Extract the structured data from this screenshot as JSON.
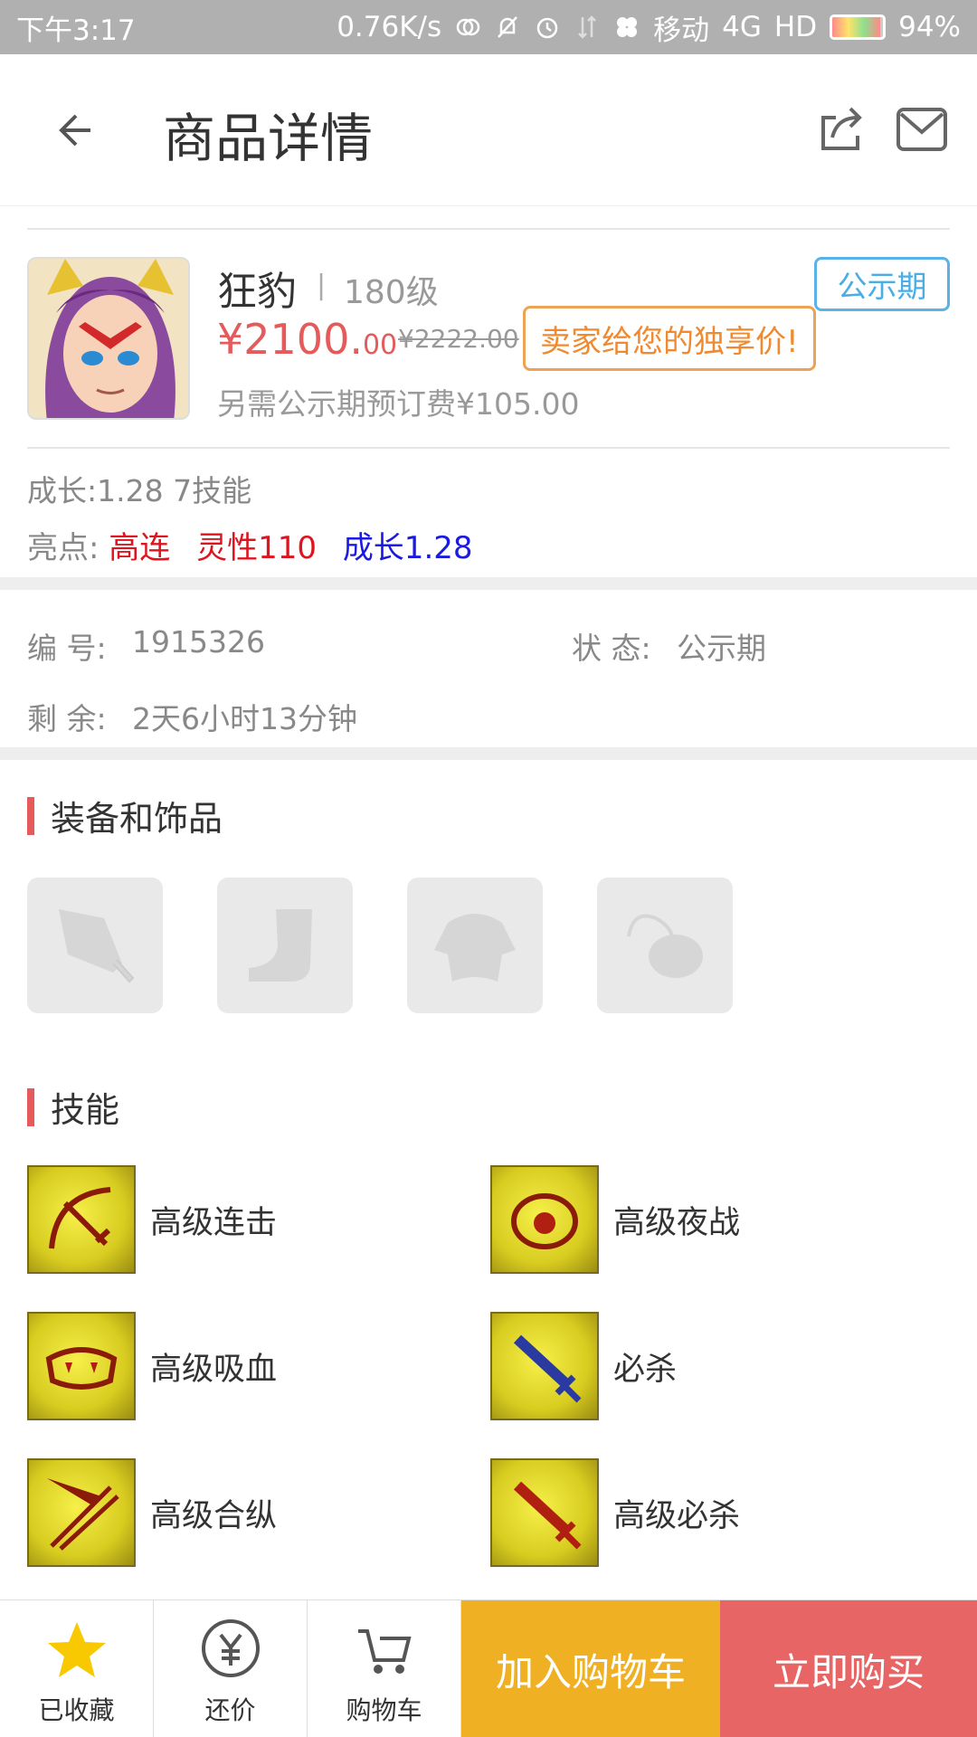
{
  "status_bar": {
    "time": "下午3:17",
    "net_speed": "0.76K/s",
    "carrier": "移动",
    "network": "4G",
    "hd": "HD",
    "battery_pct": "94%",
    "battery_level": 0.94
  },
  "header": {
    "title": "商品详情",
    "back_icon": "arrow-left-icon",
    "share_icon": "share-icon",
    "mail_icon": "mail-icon"
  },
  "product": {
    "name": "狂豹",
    "separator": "|",
    "level": "180级",
    "status_tag": "公示期",
    "price_int": "¥2100.",
    "price_dec": "00",
    "old_price": "¥2222.00",
    "exclusive_label": "卖家给您的独享价!",
    "deposit": "另需公示期预订费¥105.00",
    "growth_skills": "成长:1.28 7技能",
    "highlights_label": "亮点:",
    "highlights": [
      {
        "text": "高连",
        "color": "#e0141e"
      },
      {
        "text": "灵性110",
        "color": "#e0141e"
      },
      {
        "text": "成长1.28",
        "color": "#1a1ae0"
      }
    ]
  },
  "info": {
    "id_label": "编  号:",
    "id_value": "1915326",
    "status_label": "状  态:",
    "status_value": "公示期",
    "remaining_label": "剩  余:",
    "remaining_value": "2天6小时13分钟"
  },
  "equipment": {
    "title": "装备和饰品",
    "slots": [
      "weapon-icon",
      "boots-icon",
      "armor-icon",
      "necklace-icon"
    ]
  },
  "skills": {
    "title": "技能",
    "items": [
      {
        "name": "高级连击",
        "icon": "combo-skill-icon"
      },
      {
        "name": "高级夜战",
        "icon": "night-battle-skill-icon"
      },
      {
        "name": "高级吸血",
        "icon": "vampire-skill-icon"
      },
      {
        "name": "必杀",
        "icon": "critical-skill-icon"
      },
      {
        "name": "高级合纵",
        "icon": "alliance-skill-icon"
      },
      {
        "name": "高级必杀",
        "icon": "advanced-critical-skill-icon"
      }
    ]
  },
  "bottom_bar": {
    "favorite_label": "已收藏",
    "bargain_label": "还价",
    "cart_label": "购物车",
    "add_to_cart": "加入购物车",
    "buy_now": "立即购买"
  },
  "colors": {
    "price": "#e55a5a",
    "status_tag": "#4aaee6",
    "exclusive": "#f08a30",
    "add_to_cart_bg": "#f0b024",
    "buy_now_bg": "#e86566",
    "star": "#f8c800"
  }
}
